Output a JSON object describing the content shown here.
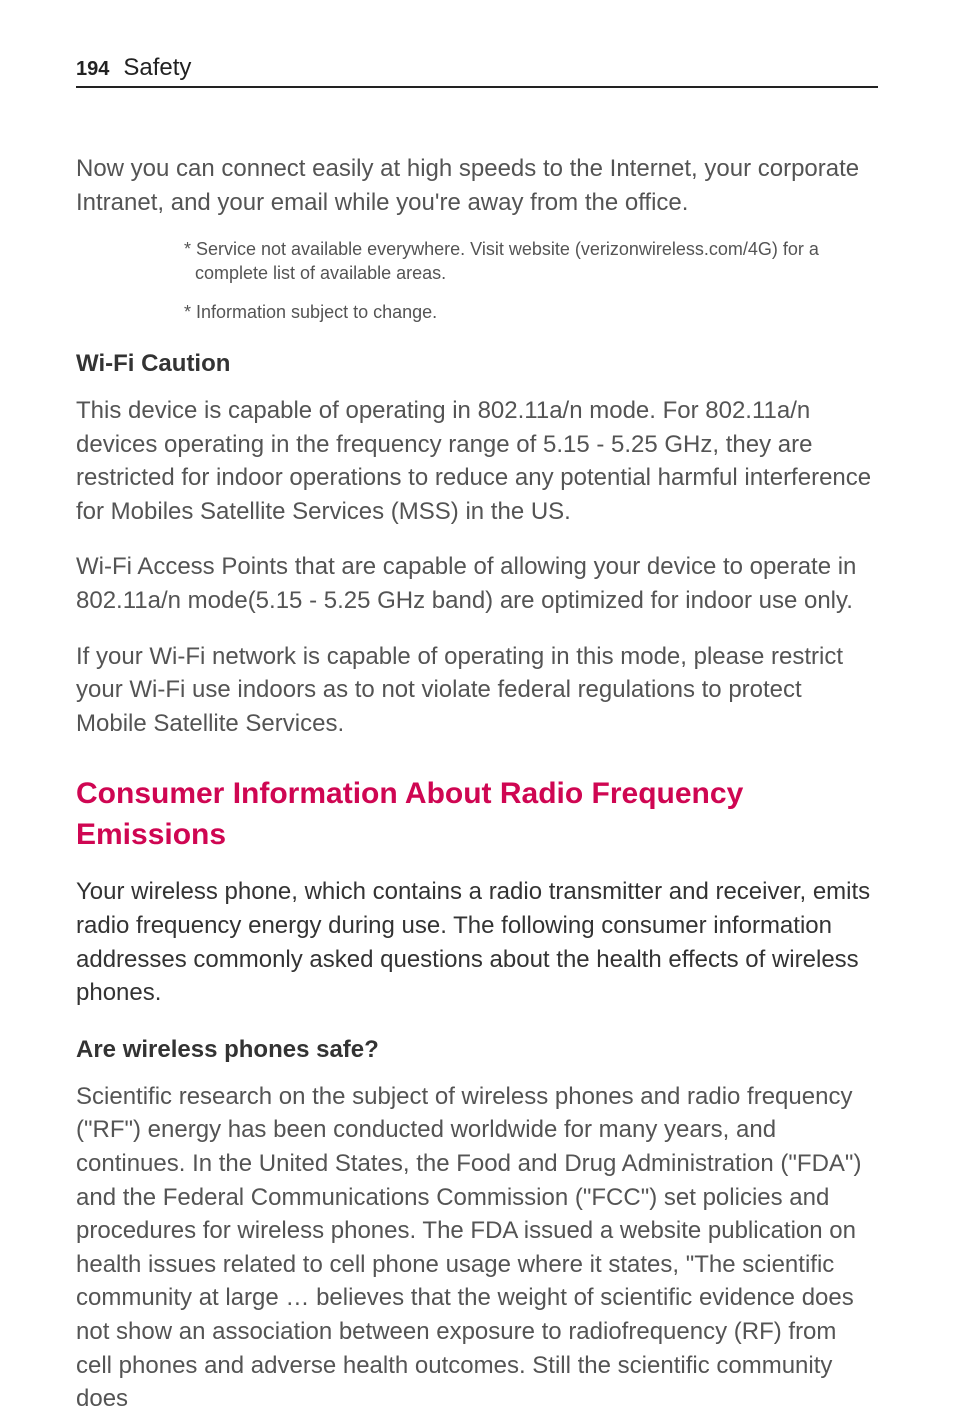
{
  "page_number": "194",
  "section_label": "Safety",
  "intro": "Now you can connect easily at high speeds to the Internet, your corporate Intranet, and your email while you're away from the office.",
  "footnotes": [
    "* Service not available everywhere. Visit website (verizonwireless.com/4G) for a complete list of available areas.",
    "* Information subject to change."
  ],
  "wifi_heading": "Wi-Fi Caution",
  "wifi_p1": "This device is capable of operating in 802.11a/n mode. For 802.11a/n devices operating in the frequency range of 5.15 - 5.25 GHz, they are restricted for indoor operations to reduce any potential harmful interference for Mobiles Satellite Services (MSS) in the US.",
  "wifi_p2": "Wi-Fi Access Points that are capable of allowing your device to operate in 802.11a/n mode(5.15 - 5.25 GHz band) are optimized for indoor use only.",
  "wifi_p3": "If your Wi-Fi network is capable of operating in this mode, please restrict your Wi-Fi use indoors as to not violate federal regulations to protect Mobile Satellite Services.",
  "consumer_heading": "Consumer Information About Radio Frequency Emissions",
  "consumer_lead": "Your wireless phone, which contains a radio transmitter and receiver, emits radio frequency energy during use. The following consumer information addresses commonly asked questions about the health effects of wireless phones.",
  "safe_heading": "Are wireless phones safe?",
  "safe_p1": "Scientific research on the subject of wireless phones and radio frequency (\"RF\") energy has been conducted worldwide for many years, and continues. In the United States, the Food and Drug Administration (\"FDA\") and the Federal Communications Commission (\"FCC\") set policies and procedures for wireless phones. The FDA issued a website publication on health issues related to cell phone usage where it states, \"The scientific community at large … believes that the weight of scientific evidence does not show an association between exposure to radiofrequency (RF) from cell phones and adverse health outcomes. Still the scientific community does"
}
